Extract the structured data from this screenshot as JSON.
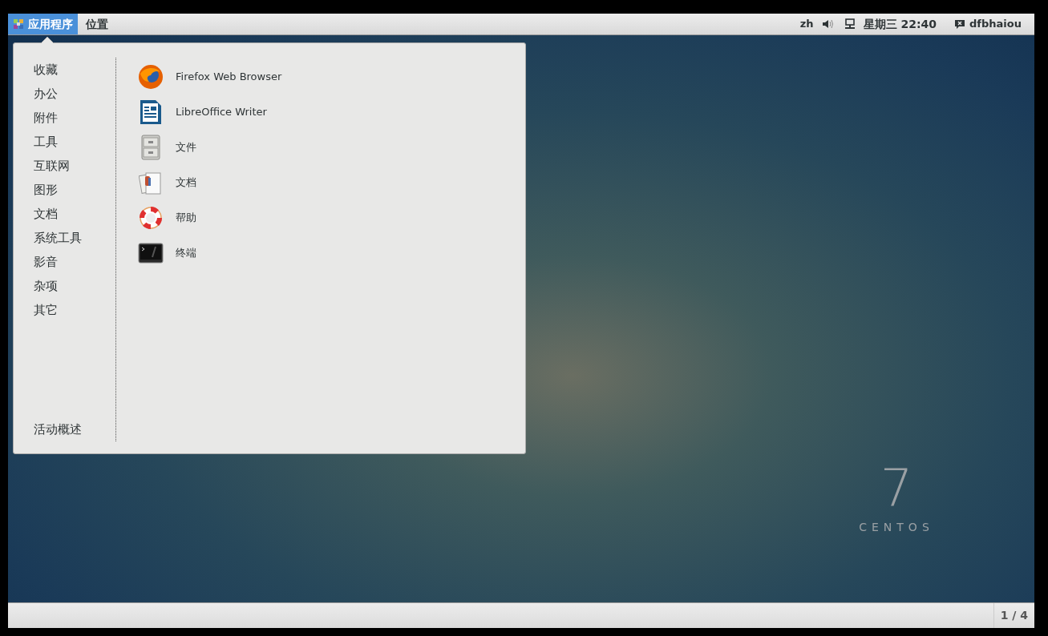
{
  "top_bar": {
    "applications_menu": {
      "label": "应用程序",
      "selected": true
    },
    "places_menu": {
      "label": "位置",
      "selected": false
    },
    "input_method": "zh",
    "clock": "星期三 22:40",
    "user": "dfbhaiou"
  },
  "app_menu": {
    "categories": [
      {
        "label": "收藏",
        "selected": false
      },
      {
        "label": "办公",
        "selected": false
      },
      {
        "label": "附件",
        "selected": false
      },
      {
        "label": "工具",
        "selected": false
      },
      {
        "label": "互联网",
        "selected": false
      },
      {
        "label": "图形",
        "selected": false
      },
      {
        "label": "文档",
        "selected": false
      },
      {
        "label": "系统工具",
        "selected": false
      },
      {
        "label": "影音",
        "selected": false
      },
      {
        "label": "杂项",
        "selected": false
      },
      {
        "label": "其它",
        "selected": false
      }
    ],
    "overview": "活动概述",
    "apps": [
      {
        "label": "Firefox Web Browser",
        "kind": "firefox"
      },
      {
        "label": "LibreOffice Writer",
        "kind": "writer"
      },
      {
        "label": "文件",
        "kind": "files"
      },
      {
        "label": "文档",
        "kind": "documents"
      },
      {
        "label": "帮助",
        "kind": "help"
      },
      {
        "label": "终端",
        "kind": "terminal"
      }
    ]
  },
  "wallpaper": {
    "version": "7",
    "brand": "CENTOS"
  },
  "bottom_bar": {
    "workspace": "1 / 4"
  }
}
